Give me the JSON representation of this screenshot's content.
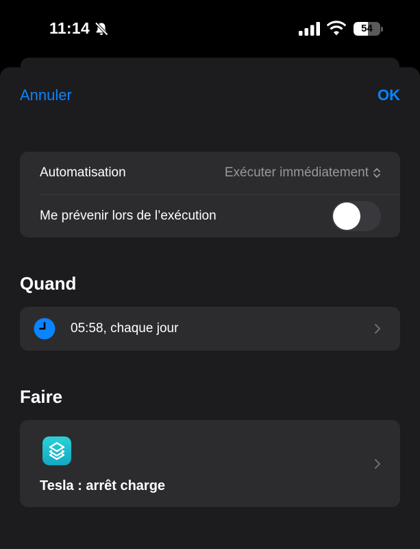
{
  "status_bar": {
    "time": "11:14",
    "battery_level": "54",
    "battery_fraction": 0.54,
    "icons": [
      "bell-slash-icon",
      "cellular-signal-icon",
      "wifi-icon",
      "battery-icon"
    ]
  },
  "nav": {
    "cancel_label": "Annuler",
    "ok_label": "OK"
  },
  "settings": {
    "automation_label": "Automatisation",
    "automation_value": "Exécuter immédiatement",
    "notify_label": "Me prévenir lors de l’exécution",
    "notify_enabled": false
  },
  "when": {
    "title": "Quand",
    "trigger_label": "05:58, chaque jour"
  },
  "do": {
    "title": "Faire",
    "action_label": "Tesla : arrêt charge"
  },
  "colors": {
    "accent": "#0a84ff",
    "background": "#1c1c1e",
    "card": "#2c2c2e",
    "secondary_text": "#98989d",
    "shortcuts_gradient_top": "#2bd1d8",
    "shortcuts_gradient_bottom": "#12a9c4"
  }
}
